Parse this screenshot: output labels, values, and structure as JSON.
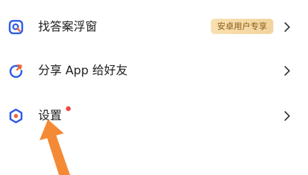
{
  "menu": {
    "items": [
      {
        "label": "找答案浮窗",
        "icon": "search-window-icon",
        "badge": "安卓用户专享"
      },
      {
        "label": "分享 App 给好友",
        "icon": "share-refresh-icon"
      },
      {
        "label": "设置",
        "icon": "settings-gear-icon",
        "has_notification_dot": true
      }
    ]
  },
  "colors": {
    "icon_blue": "#2f5bea",
    "icon_orange": "#f2673a",
    "badge_bg": "#f4d9a6",
    "badge_text": "#8a5a16",
    "notification_dot": "#f04a45",
    "pointer_arrow": "#f58a36",
    "chevron": "#333333"
  }
}
